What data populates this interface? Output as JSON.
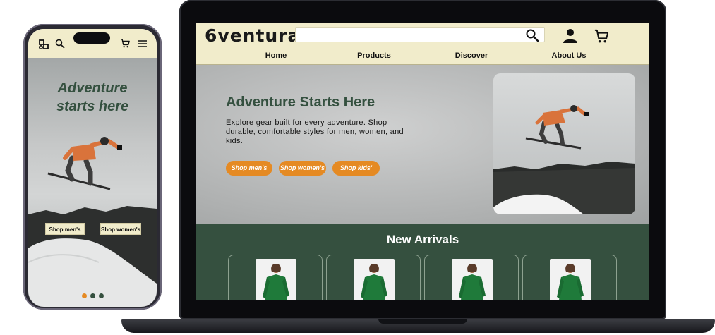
{
  "desktop": {
    "logo": "6ventura",
    "search": {
      "placeholder": ""
    },
    "nav": [
      "Home",
      "Products",
      "Discover",
      "About Us"
    ],
    "hero": {
      "title": "Adventure Starts Here",
      "text": "Explore gear built for every adventure. Shop durable, comfortable styles for men, women, and kids.",
      "buttons": [
        "Shop men's",
        "Shop women's",
        "Shop kids'"
      ]
    },
    "arrivals": {
      "title": "New Arrivals",
      "card_count": 4
    }
  },
  "mobile": {
    "hero": {
      "title_line1": "Adventure",
      "title_line2": "starts here"
    },
    "buttons": [
      "Shop men's",
      "Shop women's"
    ],
    "carousel": {
      "slides": 3,
      "active": 1
    }
  },
  "colors": {
    "header_bg": "#f1eccb",
    "brand_green": "#34503f",
    "accent_orange": "#e58a23"
  },
  "icons": [
    "search-icon",
    "user-icon",
    "cart-icon",
    "menu-icon",
    "logo-icon"
  ]
}
